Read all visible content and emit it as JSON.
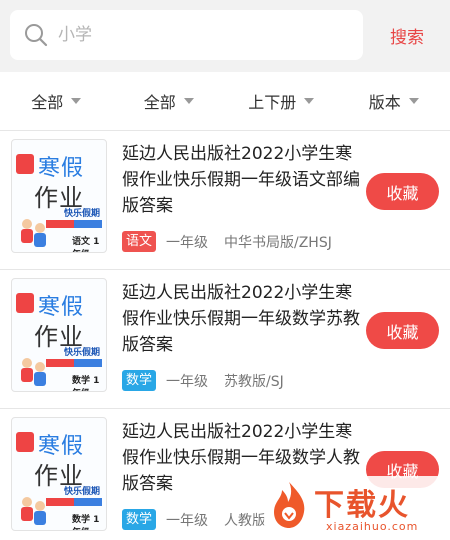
{
  "search": {
    "placeholder": "小学",
    "button_label": "搜索"
  },
  "filters": [
    {
      "label": "全部"
    },
    {
      "label": "全部"
    },
    {
      "label": "上下册"
    },
    {
      "label": "版本"
    }
  ],
  "items": [
    {
      "title": "延边人民出版社2022小学生寒假作业快乐假期一年级语文部编版答案",
      "subject": "语文",
      "subject_color": "#ef5350",
      "grade": "一年级",
      "edition": "中华书局版/ZHSJ",
      "action_label": "收藏",
      "cover": {
        "line1": "寒假",
        "line2": "作业",
        "line3": "快乐假期",
        "subject": "语文 1年级"
      }
    },
    {
      "title": "延边人民出版社2022小学生寒假作业快乐假期一年级数学苏教版答案",
      "subject": "数学",
      "subject_color": "#29a7e6",
      "grade": "一年级",
      "edition": "苏教版/SJ",
      "action_label": "收藏",
      "cover": {
        "line1": "寒假",
        "line2": "作业",
        "line3": "快乐假期",
        "subject": "数学 1年级"
      }
    },
    {
      "title": "延边人民出版社2022小学生寒假作业快乐假期一年级数学人教版答案",
      "subject": "数学",
      "subject_color": "#29a7e6",
      "grade": "一年级",
      "edition": "人教版",
      "action_label": "收藏",
      "cover": {
        "line1": "寒假",
        "line2": "作业",
        "line3": "快乐假期",
        "subject": "数学 1年级"
      }
    }
  ],
  "watermark": {
    "text": "下载火",
    "url": "xiazaihuo.com"
  }
}
